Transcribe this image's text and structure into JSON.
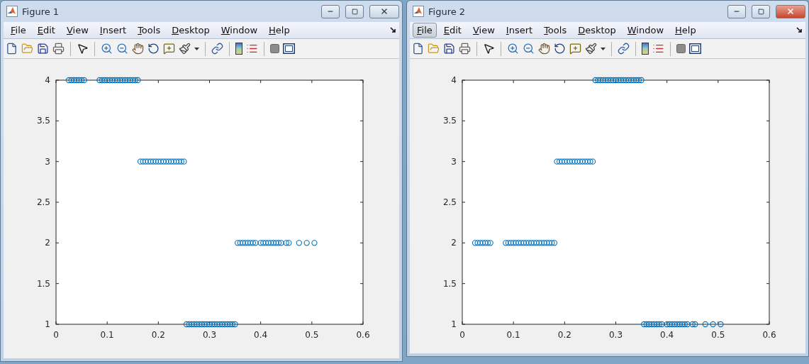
{
  "figures": [
    {
      "title": "Figure 1",
      "close_highlighted": false,
      "menu": [
        {
          "label": "File",
          "selected": false
        },
        {
          "label": "Edit",
          "selected": false
        },
        {
          "label": "View",
          "selected": false
        },
        {
          "label": "Insert",
          "selected": false
        },
        {
          "label": "Tools",
          "selected": false
        },
        {
          "label": "Desktop",
          "selected": false
        },
        {
          "label": "Window",
          "selected": false
        },
        {
          "label": "Help",
          "selected": false
        }
      ],
      "chart_data": {
        "type": "scatter",
        "xlim": [
          0,
          0.6
        ],
        "ylim": [
          1,
          4
        ],
        "xticks": [
          0,
          0.1,
          0.2,
          0.3,
          0.4,
          0.5,
          0.6
        ],
        "yticks": [
          1,
          1.5,
          2,
          2.5,
          3,
          3.5,
          4
        ],
        "x": [
          0.025,
          0.03,
          0.035,
          0.04,
          0.045,
          0.05,
          0.055,
          0.085,
          0.09,
          0.095,
          0.1,
          0.105,
          0.11,
          0.115,
          0.12,
          0.125,
          0.13,
          0.135,
          0.14,
          0.145,
          0.15,
          0.155,
          0.16,
          0.165,
          0.17,
          0.175,
          0.18,
          0.185,
          0.19,
          0.195,
          0.2,
          0.205,
          0.21,
          0.215,
          0.22,
          0.225,
          0.23,
          0.235,
          0.24,
          0.245,
          0.25,
          0.255,
          0.26,
          0.265,
          0.27,
          0.275,
          0.28,
          0.285,
          0.29,
          0.295,
          0.3,
          0.305,
          0.31,
          0.315,
          0.32,
          0.325,
          0.33,
          0.335,
          0.34,
          0.345,
          0.35,
          0.355,
          0.36,
          0.365,
          0.37,
          0.375,
          0.38,
          0.385,
          0.39,
          0.4,
          0.405,
          0.41,
          0.415,
          0.42,
          0.425,
          0.43,
          0.435,
          0.44,
          0.45,
          0.455,
          0.475,
          0.49,
          0.505
        ],
        "series": [
          {
            "color": "#0072bd",
            "values": [
              4,
              4,
              4,
              4,
              4,
              4,
              4,
              4,
              4,
              4,
              4,
              4,
              4,
              4,
              4,
              4,
              4,
              4,
              4,
              4,
              4,
              4,
              4,
              3,
              3,
              3,
              3,
              3,
              3,
              3,
              3,
              3,
              3,
              3,
              3,
              3,
              3,
              3,
              3,
              3,
              3,
              1,
              1,
              1,
              1,
              1,
              1,
              1,
              1,
              1,
              1,
              1,
              1,
              1,
              1,
              1,
              1,
              1,
              1,
              1,
              1,
              2,
              2,
              2,
              2,
              2,
              2,
              2,
              2,
              2,
              2,
              2,
              2,
              2,
              2,
              2,
              2,
              2,
              2,
              2,
              2,
              2,
              2
            ]
          }
        ]
      }
    },
    {
      "title": "Figure 2",
      "close_highlighted": true,
      "menu": [
        {
          "label": "File",
          "selected": true
        },
        {
          "label": "Edit",
          "selected": false
        },
        {
          "label": "View",
          "selected": false
        },
        {
          "label": "Insert",
          "selected": false
        },
        {
          "label": "Tools",
          "selected": false
        },
        {
          "label": "Desktop",
          "selected": false
        },
        {
          "label": "Window",
          "selected": false
        },
        {
          "label": "Help",
          "selected": false
        }
      ],
      "chart_data": {
        "type": "scatter",
        "xlim": [
          0,
          0.6
        ],
        "ylim": [
          1,
          4
        ],
        "xticks": [
          0,
          0.1,
          0.2,
          0.3,
          0.4,
          0.5,
          0.6
        ],
        "yticks": [
          1,
          1.5,
          2,
          2.5,
          3,
          3.5,
          4
        ],
        "x": [
          0.025,
          0.03,
          0.035,
          0.04,
          0.045,
          0.05,
          0.055,
          0.085,
          0.09,
          0.095,
          0.1,
          0.105,
          0.11,
          0.115,
          0.12,
          0.125,
          0.13,
          0.135,
          0.14,
          0.145,
          0.15,
          0.155,
          0.16,
          0.165,
          0.17,
          0.175,
          0.18,
          0.185,
          0.19,
          0.195,
          0.2,
          0.205,
          0.21,
          0.215,
          0.22,
          0.225,
          0.23,
          0.235,
          0.24,
          0.245,
          0.25,
          0.255,
          0.26,
          0.265,
          0.27,
          0.275,
          0.28,
          0.285,
          0.29,
          0.295,
          0.3,
          0.305,
          0.31,
          0.315,
          0.32,
          0.325,
          0.33,
          0.335,
          0.34,
          0.345,
          0.35,
          0.355,
          0.36,
          0.365,
          0.37,
          0.375,
          0.38,
          0.385,
          0.39,
          0.4,
          0.405,
          0.41,
          0.415,
          0.42,
          0.425,
          0.43,
          0.435,
          0.44,
          0.45,
          0.455,
          0.475,
          0.49,
          0.505
        ],
        "series": [
          {
            "color": "#0072bd",
            "values": [
              2,
              2,
              2,
              2,
              2,
              2,
              2,
              2,
              2,
              2,
              2,
              2,
              2,
              2,
              2,
              2,
              2,
              2,
              2,
              2,
              2,
              2,
              2,
              2,
              2,
              2,
              2,
              3,
              3,
              3,
              3,
              3,
              3,
              3,
              3,
              3,
              3,
              3,
              3,
              3,
              3,
              3,
              4,
              4,
              4,
              4,
              4,
              4,
              4,
              4,
              4,
              4,
              4,
              4,
              4,
              4,
              4,
              4,
              4,
              4,
              4,
              1,
              1,
              1,
              1,
              1,
              1,
              1,
              1,
              1,
              1,
              1,
              1,
              1,
              1,
              1,
              1,
              1,
              1,
              1,
              1,
              1,
              1
            ]
          }
        ]
      }
    }
  ]
}
